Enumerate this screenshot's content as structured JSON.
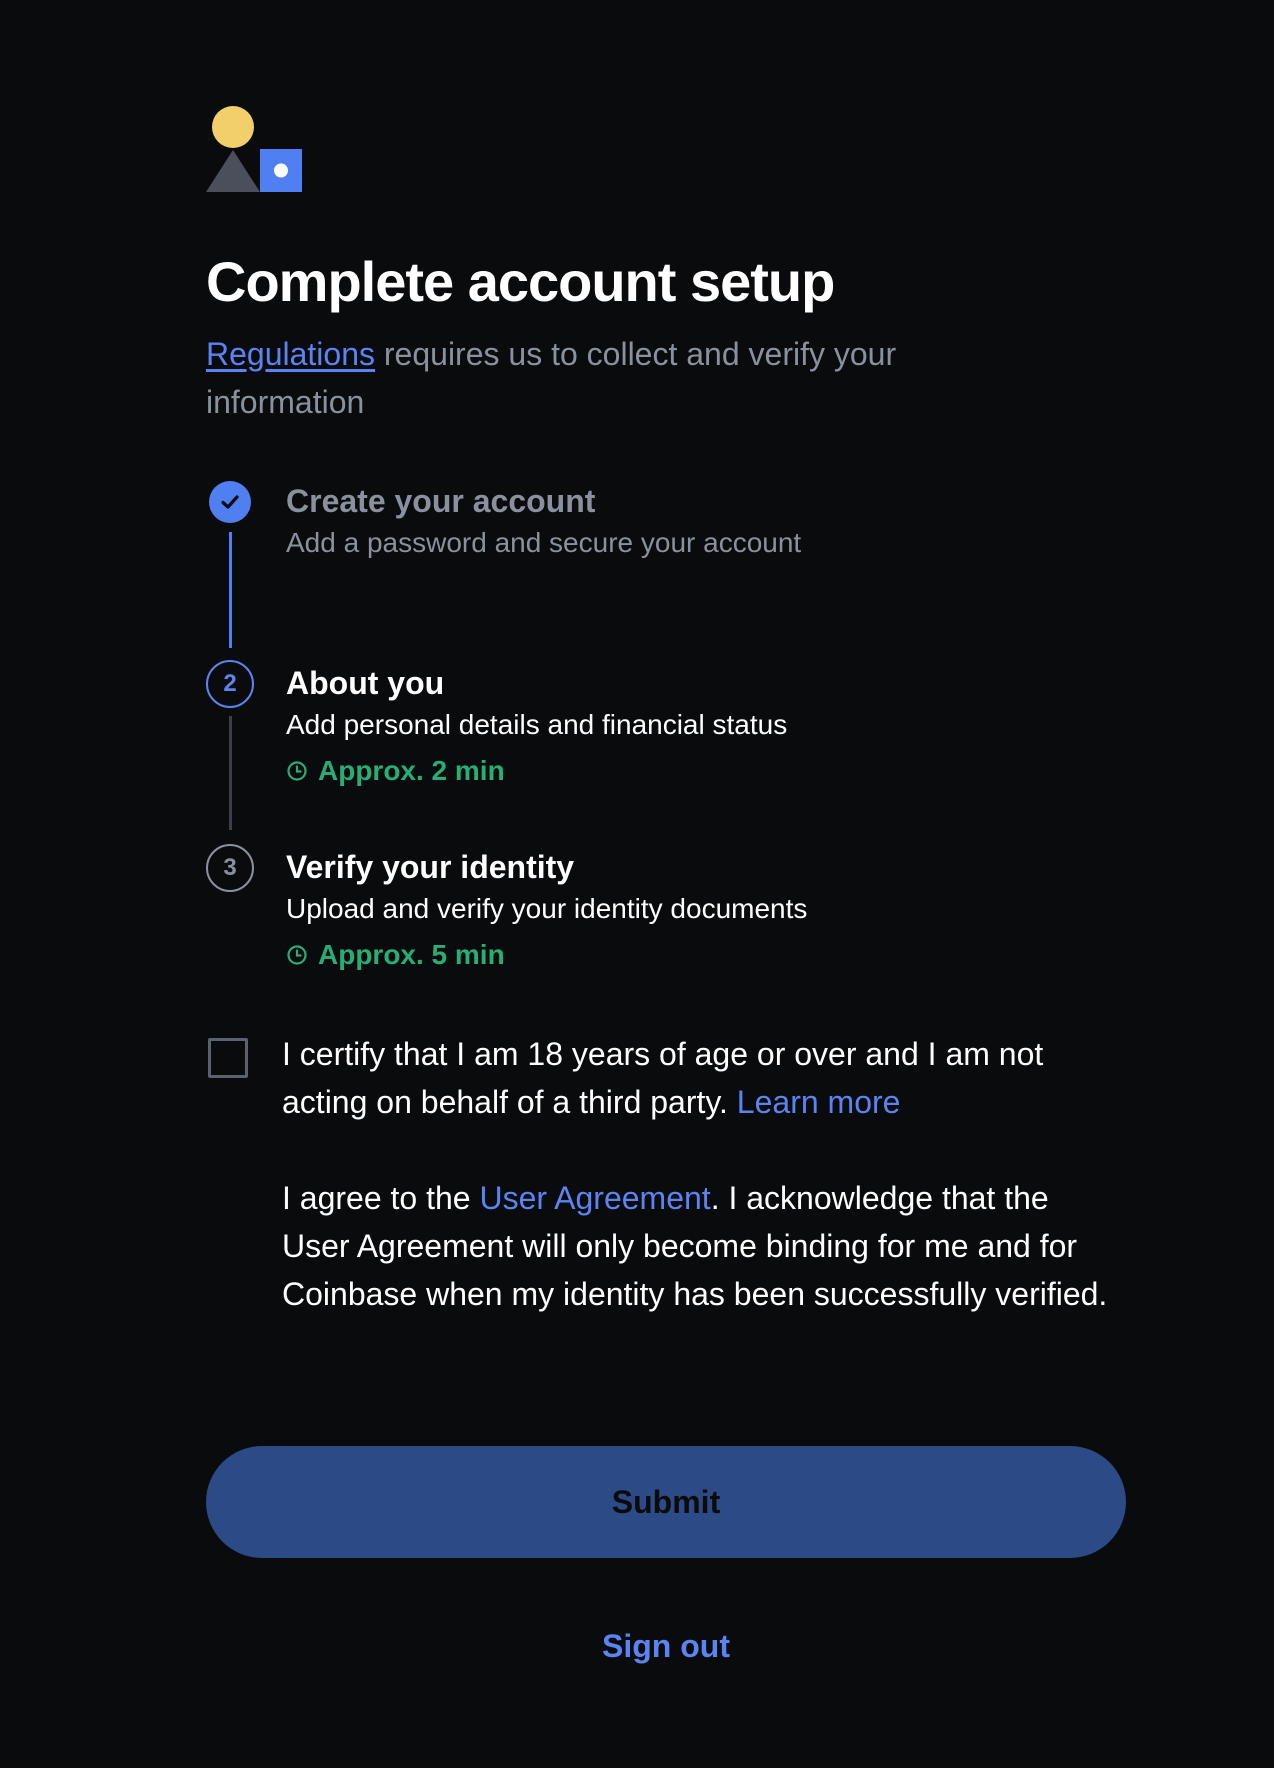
{
  "page": {
    "title": "Complete account setup",
    "subtitle_link": "Regulations",
    "subtitle_text": " requires us to collect and verify your information"
  },
  "steps": [
    {
      "status": "done",
      "title": "Create your account",
      "description": "Add a password and secure your account"
    },
    {
      "status": "active",
      "number": "2",
      "title": "About you",
      "description": "Add personal details and financial status",
      "time": "Approx. 2 min"
    },
    {
      "status": "todo",
      "number": "3",
      "title": "Verify your identity",
      "description": "Upload and verify your identity documents",
      "time": "Approx. 5 min"
    }
  ],
  "certify": {
    "checked": false,
    "text": "I certify that I am 18 years of age or over and I am not acting on behalf of a third party. ",
    "link": "Learn more"
  },
  "agreement": {
    "prefix": "I agree to the ",
    "link": "User Agreement",
    "suffix": ". I acknowledge that the User Agreement will only become binding for me and for Coinbase when my identity has been successfully verified."
  },
  "actions": {
    "submit_label": "Submit",
    "signout_label": "Sign out"
  },
  "colors": {
    "background": "#0a0b0d",
    "accent": "#5b84f2",
    "success": "#27ad75",
    "muted": "#8a919e",
    "submit_disabled": "#2c4a85"
  },
  "icons": {
    "logo": "coinbase-shapes-logo",
    "step_done": "checkmark-icon",
    "time": "clock-icon"
  }
}
